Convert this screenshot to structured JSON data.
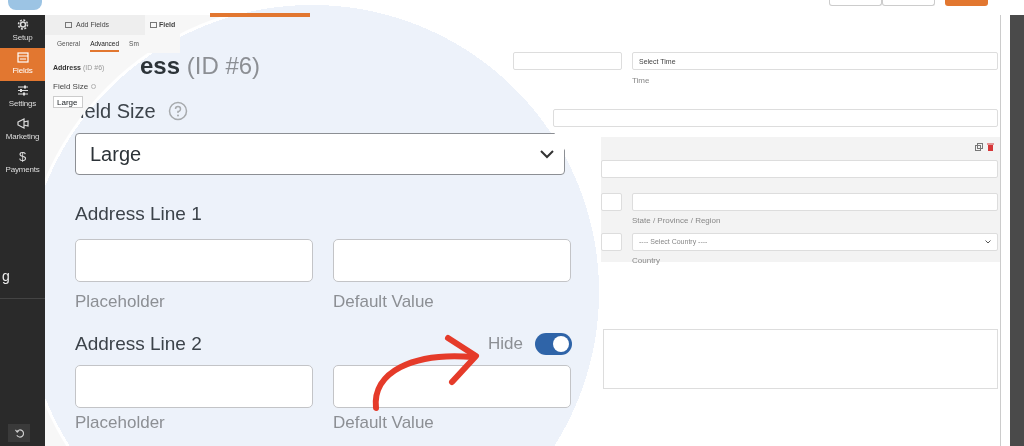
{
  "sidebar": {
    "items": [
      {
        "label": "Setup",
        "selected": false
      },
      {
        "label": "Fields",
        "selected": true
      },
      {
        "label": "Settings",
        "selected": false
      },
      {
        "label": "Marketing",
        "selected": false
      },
      {
        "label": "Payments",
        "selected": false,
        "glyph": "$"
      }
    ],
    "cut_text": "g"
  },
  "panel": {
    "tabs": [
      {
        "label": "Add Fields",
        "selected": false
      },
      {
        "label": "Field",
        "selected": true
      }
    ],
    "subtabs": [
      {
        "label": "General",
        "selected": false
      },
      {
        "label": "Advanced",
        "selected": true
      },
      {
        "label": "Sm",
        "selected": false
      }
    ],
    "field_title": "Address",
    "field_id": "(ID #6)",
    "field_size_label": "Field Size",
    "field_size_value": "Large"
  },
  "preview": {
    "time_placeholder": "Select Time",
    "time_label": "Time",
    "state_label": "State / Province / Region",
    "country_placeholder": "---- Select Country ----",
    "country_label": "Country"
  },
  "magnifier": {
    "title": "ess",
    "id": "(ID #6)",
    "field_size_label": "ield Size",
    "field_size_value": "Large",
    "lines": [
      {
        "label": "Address Line 1",
        "sublabels": [
          "Placeholder",
          "Default Value"
        ]
      },
      {
        "label": "Address Line 2",
        "hide_label": "Hide",
        "hide_on": true,
        "sublabels": [
          "Placeholder",
          "Default Value"
        ]
      }
    ]
  }
}
